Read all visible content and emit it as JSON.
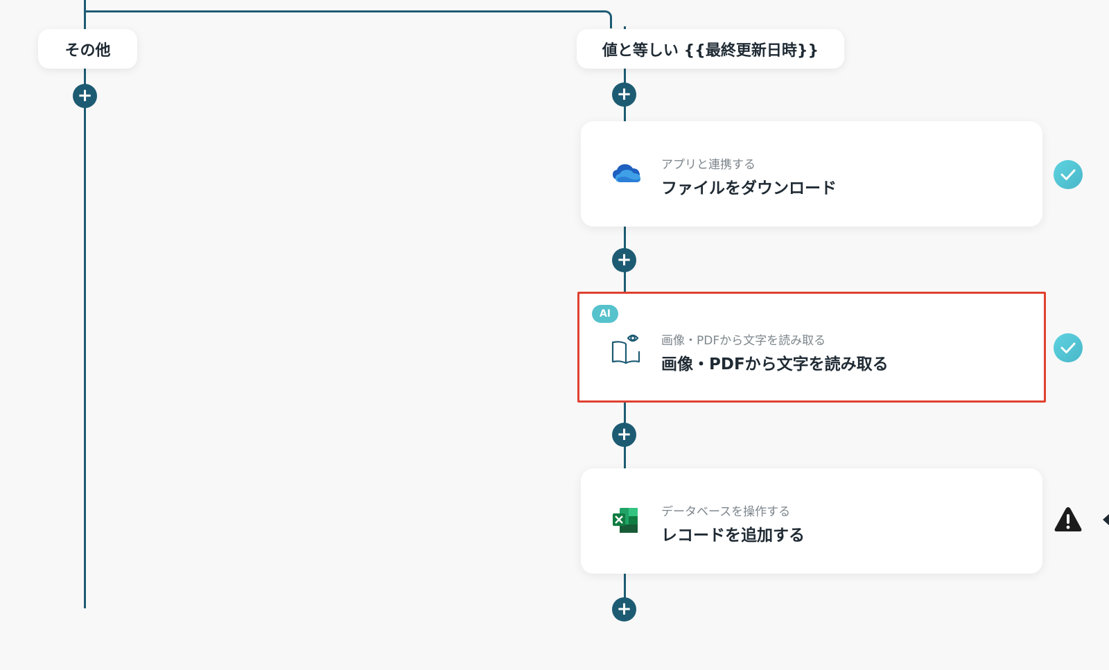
{
  "branches": {
    "left_label": "その他",
    "right_label": "値と等しい {{最終更新日時}}"
  },
  "add_step_symbol": "+",
  "steps": [
    {
      "icon": "onedrive-icon",
      "subtitle": "アプリと連携する",
      "title": "ファイルをダウンロード",
      "status": "complete"
    },
    {
      "icon": "book-eye-icon",
      "badge": "AI",
      "subtitle": "画像・PDFから文字を読み取る",
      "title": "画像・PDFから文字を読み取る",
      "status": "complete",
      "selected": true
    },
    {
      "icon": "excel-icon",
      "subtitle": "データベースを操作する",
      "title": "レコードを追加する",
      "status": "warning"
    }
  ],
  "colors": {
    "connector": "#1d5b73",
    "selection_border": "#e0402f",
    "check_badge": "#56c2cc",
    "background": "#f8f8f8"
  }
}
